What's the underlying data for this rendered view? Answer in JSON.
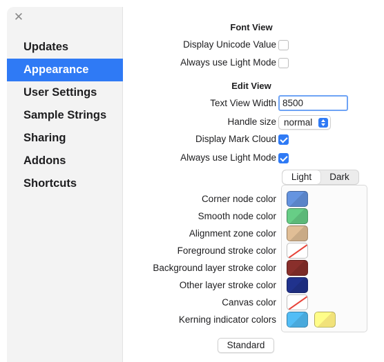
{
  "window": {
    "close_glyph": "✕"
  },
  "sidebar": {
    "items": [
      {
        "label": "Updates",
        "active": false
      },
      {
        "label": "Appearance",
        "active": true
      },
      {
        "label": "User Settings",
        "active": false
      },
      {
        "label": "Sample Strings",
        "active": false
      },
      {
        "label": "Sharing",
        "active": false
      },
      {
        "label": "Addons",
        "active": false
      },
      {
        "label": "Shortcuts",
        "active": false
      }
    ]
  },
  "font_view": {
    "title": "Font View",
    "display_unicode": {
      "label": "Display Unicode Value",
      "checked": false
    },
    "light_mode": {
      "label": "Always use Light Mode",
      "checked": false
    }
  },
  "edit_view": {
    "title": "Edit View",
    "text_width": {
      "label": "Text View Width",
      "value": "8500"
    },
    "handle_size": {
      "label": "Handle size",
      "value": "normal"
    },
    "mark_cloud": {
      "label": "Display Mark Cloud",
      "checked": true
    },
    "light_mode": {
      "label": "Always use Light Mode",
      "checked": true
    }
  },
  "theme_tabs": {
    "light": "Light",
    "dark": "Dark",
    "selected": "Light"
  },
  "colors": {
    "corner": {
      "label": "Corner node color",
      "value": "#5a84c8"
    },
    "smooth": {
      "label": "Smooth node color",
      "value": "#5cb878"
    },
    "alignment": {
      "label": "Alignment zone color",
      "value": "#c9aa86"
    },
    "foreground": {
      "label": "Foreground stroke color",
      "value": "none"
    },
    "background": {
      "label": "Background layer stroke color",
      "value": "#7a2a26"
    },
    "other": {
      "label": "Other layer stroke color",
      "value": "#1d2d7e"
    },
    "canvas": {
      "label": "Canvas color",
      "value": "none"
    },
    "kerning": {
      "label": "Kerning indicator colors",
      "values": [
        "#49a9dc",
        "#f1e27a"
      ]
    }
  },
  "standard_button": "Standard"
}
